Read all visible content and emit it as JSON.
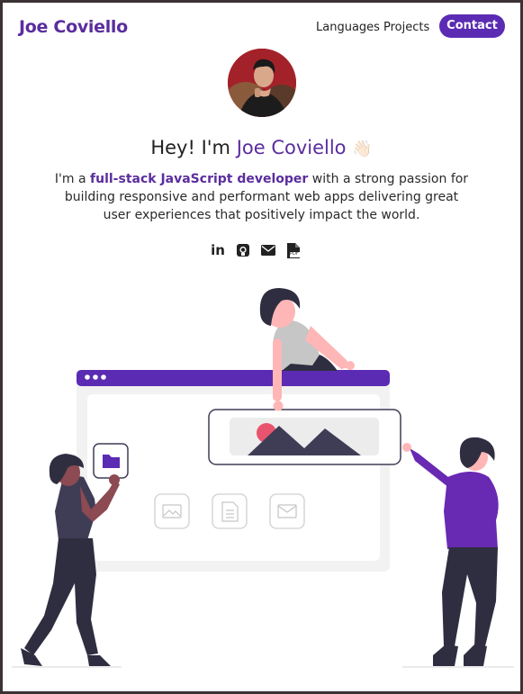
{
  "header": {
    "brand": "Joe Coviello",
    "nav": {
      "languages": "Languages",
      "projects": "Projects",
      "contact": "Contact"
    }
  },
  "hero": {
    "greeting_prefix": "Hey! I'm ",
    "greeting_name": "Joe Coviello",
    "wave_emoji": "👋🏻",
    "intro_prefix": "I'm a ",
    "intro_highlight": "full-stack JavaScript developer",
    "intro_rest": " with a strong passion for building responsive and performant web apps delivering great user experiences that positively impact the world."
  },
  "socials": [
    {
      "icon": "linkedin-icon",
      "text": "in"
    },
    {
      "icon": "github-icon"
    },
    {
      "icon": "email-icon"
    },
    {
      "icon": "resume-pdf-icon",
      "text": "PDF"
    }
  ],
  "colors": {
    "accent": "#5b2d9e",
    "button": "#5b2bb3",
    "text": "#222222",
    "illustration_dark": "#2f2e41",
    "illustration_pink": "#ffb6b6"
  }
}
